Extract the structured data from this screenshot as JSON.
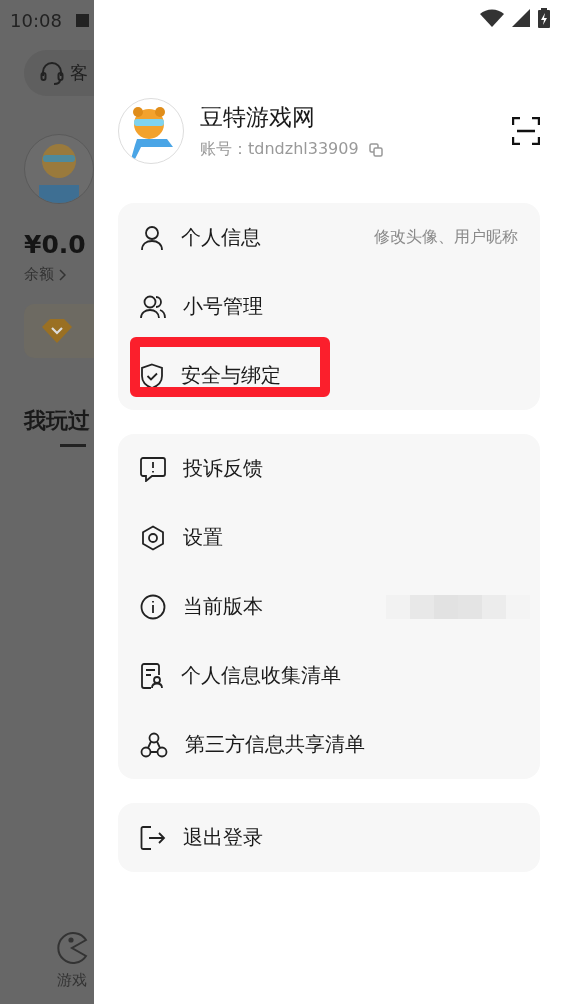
{
  "status_bar": {
    "time": "10:08"
  },
  "background_page": {
    "service_button": "客",
    "balance": "¥0.0",
    "balance_label": "余额",
    "section_title": "我玩过",
    "nav_items": [
      {
        "label": "游戏",
        "selected": false
      }
    ]
  },
  "drawer": {
    "user": {
      "name": "豆特游戏网",
      "account": "账号：tdndzhl33909"
    },
    "menu_groups": [
      {
        "items": [
          {
            "kind": "person",
            "label": "个人信息",
            "hint": "修改头像、用户昵称",
            "highlighted": false,
            "redacted": false
          },
          {
            "kind": "people",
            "label": "小号管理",
            "highlighted": false,
            "redacted": false
          },
          {
            "kind": "shield",
            "label": "安全与绑定",
            "highlighted": true,
            "redacted": false
          }
        ]
      },
      {
        "items": [
          {
            "kind": "feedback",
            "label": "投诉反馈",
            "highlighted": false,
            "redacted": false
          },
          {
            "kind": "settings",
            "label": "设置",
            "highlighted": false,
            "redacted": false
          },
          {
            "kind": "info",
            "label": "当前版本",
            "highlighted": false,
            "redacted": true
          },
          {
            "kind": "document",
            "label": "个人信息收集清单",
            "highlighted": false,
            "redacted": false
          },
          {
            "kind": "share",
            "label": "第三方信息共享清单",
            "highlighted": false,
            "redacted": false
          }
        ]
      },
      {
        "items": [
          {
            "kind": "logout",
            "label": "退出登录",
            "highlighted": false,
            "redacted": false
          }
        ]
      }
    ]
  }
}
